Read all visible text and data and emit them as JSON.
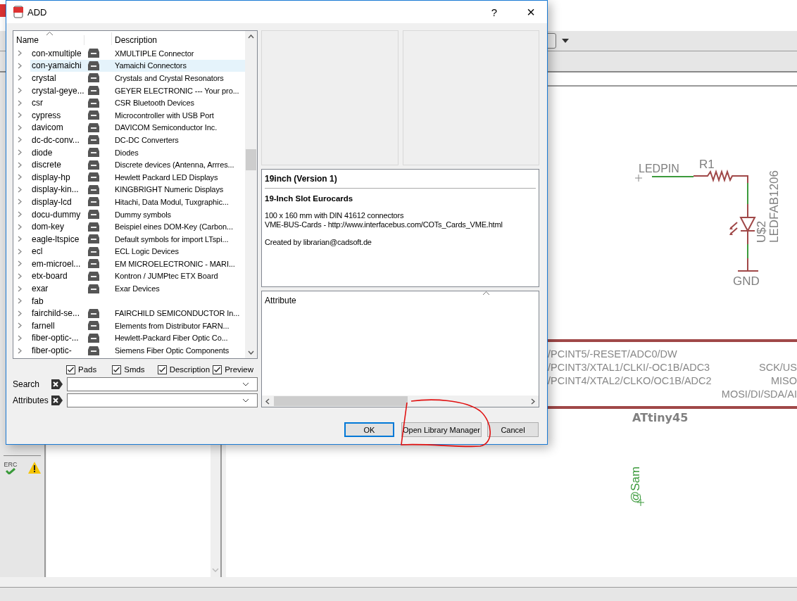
{
  "dialog": {
    "title": "ADD",
    "help": "?",
    "close": "×",
    "list": {
      "columns": [
        "Name",
        "Description"
      ],
      "rows": [
        {
          "name": "con-xmultiple",
          "icon": true,
          "description": "XMULTIPLE Connector",
          "selected": false
        },
        {
          "name": "con-yamaichi",
          "icon": true,
          "description": "Yamaichi Connectors",
          "selected": true
        },
        {
          "name": "crystal",
          "icon": true,
          "description": "Crystals and Crystal Resonators",
          "selected": false
        },
        {
          "name": "crystal-geye...",
          "icon": true,
          "description": "GEYER ELECTRONIC --- Your pro...",
          "selected": false
        },
        {
          "name": "csr",
          "icon": true,
          "description": "CSR Bluetooth Devices",
          "selected": false
        },
        {
          "name": "cypress",
          "icon": true,
          "description": "Microcontroller with USB Port",
          "selected": false
        },
        {
          "name": "davicom",
          "icon": true,
          "description": "DAVICOM Semiconductor Inc.",
          "selected": false
        },
        {
          "name": "dc-dc-conv...",
          "icon": true,
          "description": "DC-DC Converters",
          "selected": false
        },
        {
          "name": "diode",
          "icon": true,
          "description": "Diodes",
          "selected": false
        },
        {
          "name": "discrete",
          "icon": true,
          "description": "Discrete devices (Antenna, Arrres...",
          "selected": false
        },
        {
          "name": "display-hp",
          "icon": true,
          "description": "Hewlett Packard LED Displays",
          "selected": false
        },
        {
          "name": "display-kin...",
          "icon": true,
          "description": "KINGBRIGHT Numeric Displays",
          "selected": false
        },
        {
          "name": "display-lcd",
          "icon": true,
          "description": "Hitachi, Data Modul, Tuxgraphic...",
          "selected": false
        },
        {
          "name": "docu-dummy",
          "icon": true,
          "description": "Dummy symbols",
          "selected": false
        },
        {
          "name": "dom-key",
          "icon": true,
          "description": "Beispiel eines DOM-Key (Carbon...",
          "selected": false
        },
        {
          "name": "eagle-ltspice",
          "icon": true,
          "description": "Default symbols for import LTspi...",
          "selected": false
        },
        {
          "name": "ecl",
          "icon": true,
          "description": "ECL Logic Devices",
          "selected": false
        },
        {
          "name": "em-microel...",
          "icon": true,
          "description": "EM MICROELECTRONIC - MARI...",
          "selected": false
        },
        {
          "name": "etx-board",
          "icon": true,
          "description": "Kontron / JUMPtec ETX Board",
          "selected": false
        },
        {
          "name": "exar",
          "icon": true,
          "description": "Exar Devices",
          "selected": false
        },
        {
          "name": "fab",
          "icon": false,
          "selected": false
        },
        {
          "name": "fairchild-se...",
          "icon": true,
          "description": "FAIRCHILD SEMICONDUCTOR In...",
          "selected": false
        },
        {
          "name": "farnell",
          "icon": true,
          "description": "Elements from Distributor FARN...",
          "selected": false
        },
        {
          "name": "fiber-optic-...",
          "icon": true,
          "description": "Hewlett-Packard Fiber Optic Co...",
          "selected": false
        },
        {
          "name": "fiber-optic-",
          "icon": true,
          "description": "Siemens Fiber Optic Components",
          "selected": false
        }
      ]
    },
    "filters": [
      {
        "label": "Pads",
        "checked": true
      },
      {
        "label": "Smds",
        "checked": true
      },
      {
        "label": "Description",
        "checked": true
      },
      {
        "label": "Preview",
        "checked": true
      }
    ],
    "search": {
      "label": "Search"
    },
    "attributes": {
      "label": "Attributes"
    },
    "info": {
      "title": "19inch (Version 1)",
      "heading": "19-Inch Slot Eurocards",
      "paragraphs": [
        [
          "100 x 160 mm with DIN 41612 connectors",
          "VME-BUS-Cards - http://www.interfacebus.com/COTs_Cards_VME.html"
        ],
        [
          "Created by librarian@cadsoft.de"
        ]
      ]
    },
    "attribute_panel": {
      "header": "Attribute"
    },
    "buttons": [
      {
        "label": "OK",
        "default": true
      },
      {
        "label": "Open Library Manager",
        "default": false
      },
      {
        "label": "Cancel",
        "default": false
      }
    ]
  },
  "sidebar": {
    "erc": "ERC"
  },
  "schematic": {
    "net_label": "LEDPIN",
    "resistor": "R1",
    "led_name": "U$2",
    "led_value": "LEDFAB1206",
    "ground": "GND",
    "chip": {
      "pins_left": [
        "/PCINT5/-RESET/ADC0/DW",
        "/PCINT3/XTAL1/CLKI/-OC1B/ADC3",
        "/PCINT4/XTAL2/CLKO/OC1B/ADC2"
      ],
      "pins_right": [
        "SCK/US",
        "MISO",
        "MOSI/DI/SDA/AI"
      ],
      "name": "ATtiny45"
    },
    "note": "@Sam"
  }
}
